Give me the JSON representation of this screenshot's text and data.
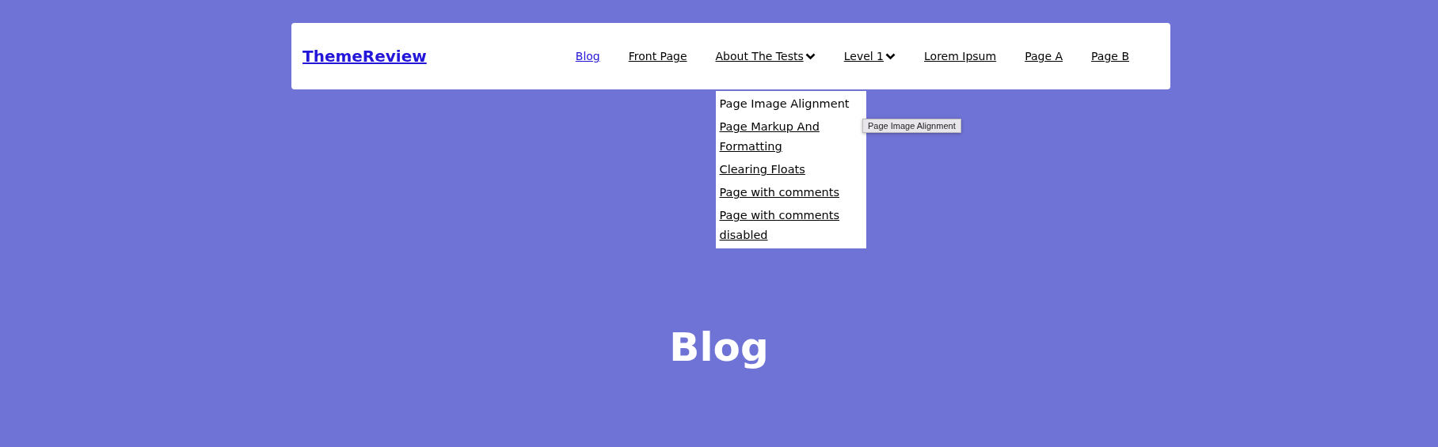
{
  "header": {
    "site_title": "ThemeReview",
    "nav": [
      {
        "label": "Blog",
        "current": true,
        "has_submenu": false
      },
      {
        "label": "Front Page",
        "current": false,
        "has_submenu": false
      },
      {
        "label": "About The Tests",
        "current": false,
        "has_submenu": true,
        "expanded": true
      },
      {
        "label": "Level 1",
        "current": false,
        "has_submenu": true,
        "expanded": false
      },
      {
        "label": "Lorem Ipsum",
        "current": false,
        "has_submenu": false
      },
      {
        "label": "Page A",
        "current": false,
        "has_submenu": false
      },
      {
        "label": "Page B",
        "current": false,
        "has_submenu": false
      }
    ],
    "submenu": [
      {
        "label": "Page Image Alignment",
        "hovered": true
      },
      {
        "label": "Page Markup And Formatting",
        "hovered": false
      },
      {
        "label": "Clearing Floats",
        "hovered": false
      },
      {
        "label": "Page with comments",
        "hovered": false
      },
      {
        "label": "Page with comments disabled",
        "hovered": false
      }
    ],
    "tooltip": "Page Image Alignment"
  },
  "page_title": "Blog"
}
